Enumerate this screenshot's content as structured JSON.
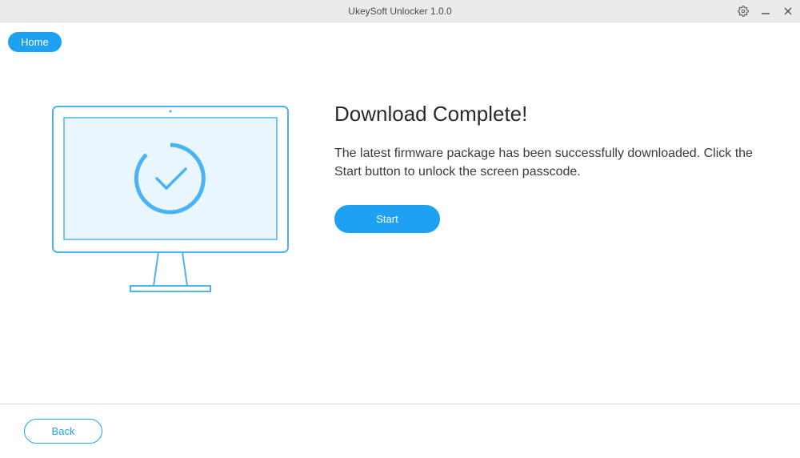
{
  "titlebar": {
    "title": "UkeySoft Unlocker 1.0.0"
  },
  "tabs": {
    "home_label": "Home"
  },
  "main": {
    "heading": "Download Complete!",
    "description": "The latest firmware package has been successfully downloaded. Click the Start button to unlock the screen passcode.",
    "start_label": "Start"
  },
  "footer": {
    "back_label": "Back"
  }
}
